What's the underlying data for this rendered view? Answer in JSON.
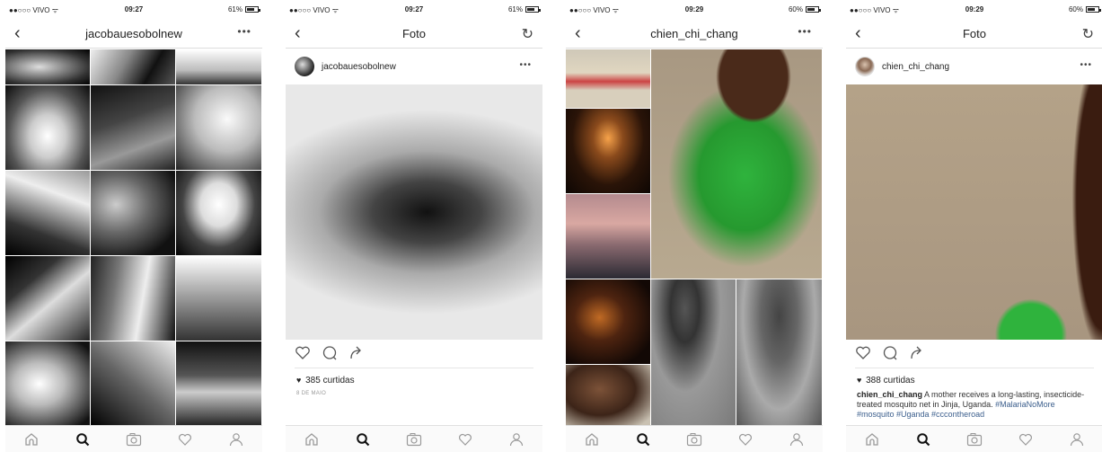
{
  "status_bar": [
    {
      "carrier": "●●○○○ VIVO ᯤ",
      "time": "09:27",
      "battery": "61%",
      "battery_level": 0.61
    },
    {
      "carrier": "●●○○○ VIVO ᯤ",
      "time": "09:27",
      "battery": "61%",
      "battery_level": 0.61
    },
    {
      "carrier": "●●○○○ VIVO ᯤ",
      "time": "09:29",
      "battery": "60%",
      "battery_level": 0.6
    },
    {
      "carrier": "●●○○○ VIVO ᯤ",
      "time": "09:29",
      "battery": "60%",
      "battery_level": 0.6
    }
  ],
  "screens": [
    {
      "nav_title": "jacobauesobolnew",
      "nav_right": "more-icon"
    },
    {
      "nav_title": "Foto",
      "nav_right": "refresh-icon",
      "post_user": "jacobauesobolnew",
      "likes": "385 curtidas",
      "date": "8 DE MAIO"
    },
    {
      "nav_title": "chien_chi_chang",
      "nav_right": "more-icon"
    },
    {
      "nav_title": "Foto",
      "nav_right": "refresh-icon",
      "post_user": "chien_chi_chang",
      "likes": "388 curtidas",
      "caption_user": "chien_chi_chang",
      "caption_text": " A mother receives a long-lasting, insecticide-treated mosquito net in Jinja, Uganda. ",
      "caption_tags": "#MalariaNoMore #mosquito #Uganda #cccontheroad"
    }
  ],
  "glyphs": {
    "back": "‹",
    "more": "•••",
    "refresh": "↻",
    "heart_small": "♥"
  },
  "tabbar_icons": [
    "home-icon",
    "search-icon",
    "camera-icon",
    "heart-icon",
    "profile-icon"
  ],
  "colors": {
    "hashtag": "#3b5e8c",
    "green_dress": "#2fb33d",
    "skin": "#6b3a22"
  }
}
